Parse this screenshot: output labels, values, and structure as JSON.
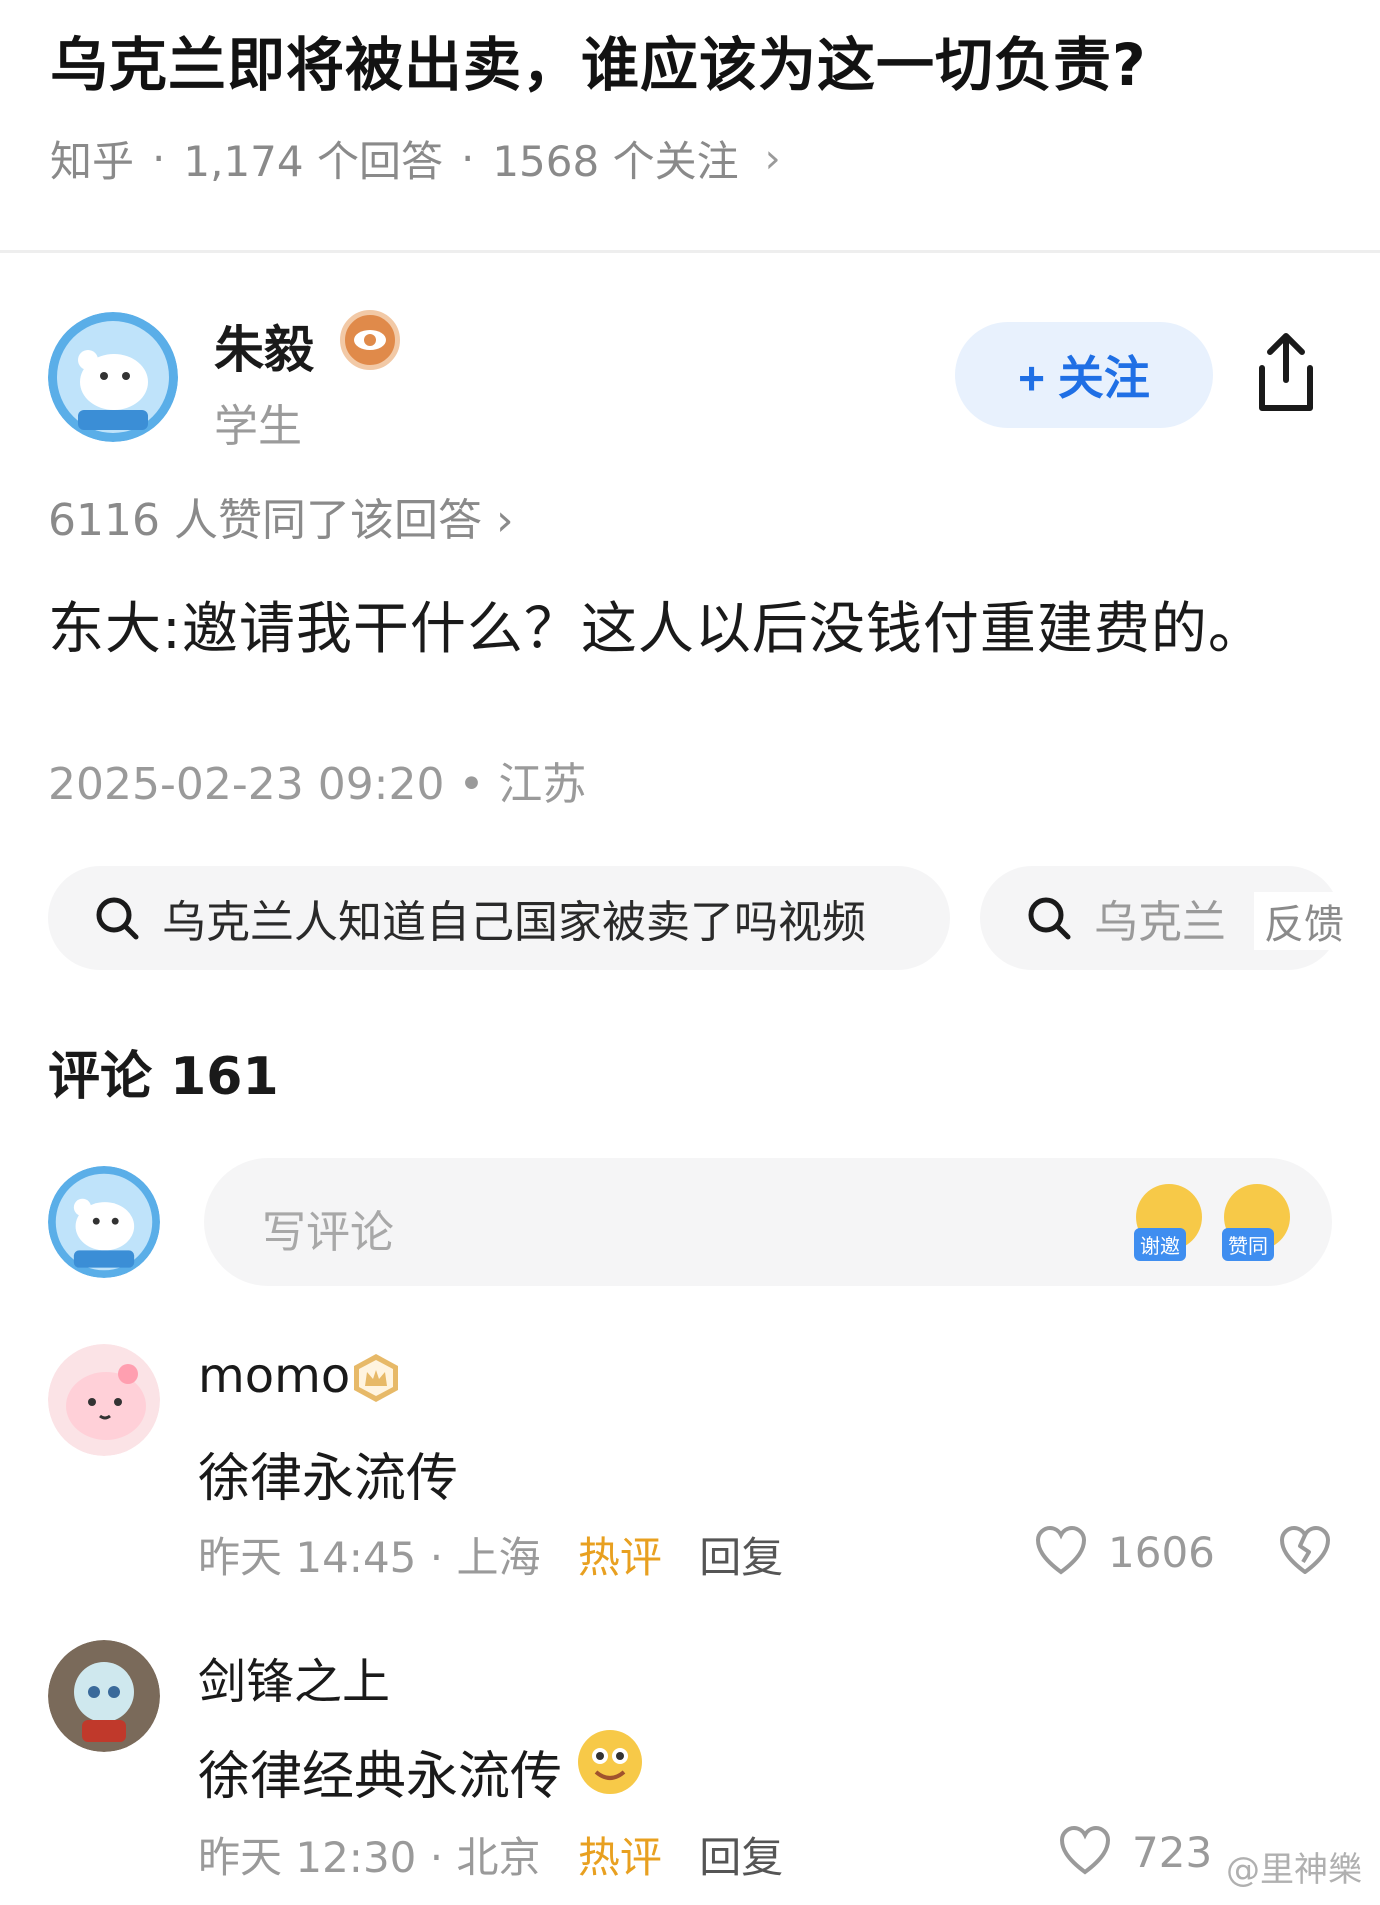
{
  "question": {
    "title": "乌克兰即将被出卖，谁应该为这一切负责?",
    "source": "知乎",
    "answers": "1,174 个回答",
    "followers": "1568 个关注",
    "chevron": "›"
  },
  "answer": {
    "author_name": "朱毅",
    "author_badge_icon": "eye-badge-icon",
    "author_title": "学生",
    "follow_label": "+ 关注",
    "agree_text": "6116 人赞同了该回答 ›",
    "content": "东大:邀请我干什么？这人以后没钱付重建费的。",
    "date_location": "2025-02-23 09:20 • 江苏"
  },
  "related_search": {
    "chips": [
      {
        "label": "乌克兰人知道自己国家被卖了吗视频"
      },
      {
        "label": "乌克兰"
      }
    ],
    "feedback": "反馈"
  },
  "comments": {
    "header": "评论 161",
    "input_placeholder": "写评论",
    "emoji_buttons": [
      {
        "icon": "thanks-invite-emoji-icon",
        "tag": "谢邀"
      },
      {
        "icon": "agree-emoji-icon",
        "tag": "赞同"
      }
    ],
    "items": [
      {
        "user": "momo",
        "text": "徐律永流传",
        "time": "昨天 14:45",
        "location": "上海",
        "hot": "热评",
        "reply": "回复",
        "likes": "1606"
      },
      {
        "user": "剑锋之上",
        "text": "徐律经典永流传",
        "time": "昨天 12:30",
        "location": "北京",
        "hot": "热评",
        "reply": "回复",
        "likes": "723"
      }
    ]
  },
  "watermark": "@里神樂",
  "colors": {
    "accent_blue": "#1f6fe5",
    "follow_bg": "#e8f1fd",
    "hot_orange": "#e8a020",
    "muted_text": "#9a9a9a"
  }
}
